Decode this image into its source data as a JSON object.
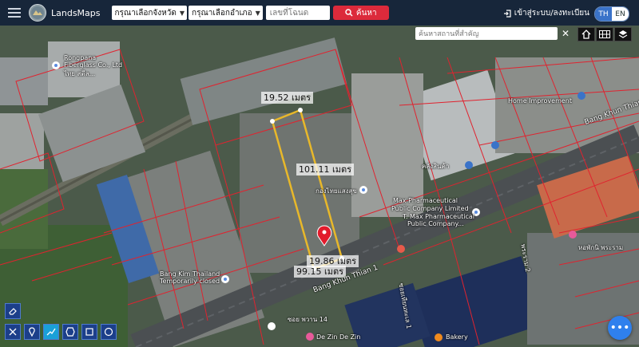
{
  "header": {
    "brand": "LandsMaps",
    "province_select": "กรุณาเลือกจังหวัด",
    "district_select": "กรุณาเลือกอำเภอ",
    "parcel_placeholder": "เลขที่โฉนด",
    "search_label": "ค้นหา",
    "login_label": "เข้าสู่ระบบ/ลงทะเบียน",
    "lang_th": "TH",
    "lang_en": "EN"
  },
  "map": {
    "place_search_placeholder": "ค้นหาสถานที่สำคัญ",
    "close_symbol": "✕",
    "measurements": {
      "top": "19.52 เมตร",
      "side": "101.11 เมตร",
      "bottom": "19.86 เมตร",
      "diag": "99.15 เมตร"
    },
    "labels": [
      {
        "key": "rongpana",
        "text": "Rongpana"
      },
      {
        "key": "fiberglass",
        "text": "Fiberglass Co., Ltd"
      },
      {
        "key": "thai_std",
        "text": "ไทย สตีล..."
      },
      {
        "key": "maxpharma",
        "text": "Max Pharmaceutical"
      },
      {
        "key": "maxpublic",
        "text": "Public Company Limited"
      },
      {
        "key": "maxthai",
        "text": "T. Max Pharmaceutical"
      },
      {
        "key": "maxcomp",
        "text": "Public Company..."
      },
      {
        "key": "bangkim",
        "text": "Bang Kim Thailand"
      },
      {
        "key": "tempclosed",
        "text": "Temporarily closed"
      },
      {
        "key": "bangkhunthian",
        "text": "Bang Khun Thian"
      },
      {
        "key": "bangkhunthian2",
        "text": "Bang Khun Thian 1"
      },
      {
        "key": "rama2",
        "text": "พระราม 2"
      },
      {
        "key": "soi14",
        "text": "ซอย พวาน 14"
      },
      {
        "key": "zinde",
        "text": "De Zin De Zin"
      },
      {
        "key": "bakery",
        "text": "Bakery"
      },
      {
        "key": "homegov",
        "text": "Home Improvement"
      },
      {
        "key": "warehouse",
        "text": "คลังสินค้า"
      },
      {
        "key": "kongthai",
        "text": "กองไทยแสงสุข"
      },
      {
        "key": "tesco",
        "text": "หอพักนิ พระราม"
      },
      {
        "key": "soi1",
        "text": "ซอยเทียนทะเล 1"
      }
    ]
  },
  "tools": {
    "eraser": "eraser-icon",
    "measure": "ruler-icon",
    "pin": "pin-icon",
    "line": "polyline-icon",
    "polygon": "polygon-icon",
    "rect": "rectangle-icon",
    "circle": "circle-icon"
  },
  "colors": {
    "topbar": "#17263a",
    "accent_red": "#dc2a3b",
    "parcel_lines": "#e0232f",
    "measure_line": "#e8b82a",
    "chat": "#2f80ed"
  }
}
